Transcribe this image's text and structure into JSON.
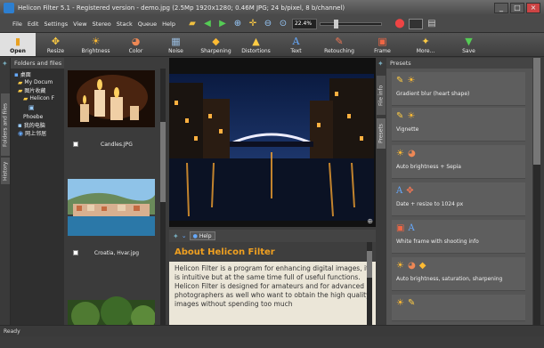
{
  "window": {
    "title": "Helicon Filter 5.1 - Registered version - demo.jpg (2.5Mp 1920x1280; 0.46M JPG; 24 b/pixel, 8 b/channel)",
    "minimize": "_",
    "maximize": "□",
    "close": "×"
  },
  "menu": [
    "File",
    "Edit",
    "Settings",
    "View",
    "Stereo",
    "Stack",
    "Queue",
    "Help"
  ],
  "zoom": {
    "value": "22.4%",
    "level": 0.224
  },
  "tools": [
    {
      "label": "Open",
      "icon": "▮"
    },
    {
      "label": "Resize",
      "icon": "✥"
    },
    {
      "label": "Brightness",
      "icon": "☀"
    },
    {
      "label": "Color",
      "icon": "◕"
    },
    {
      "label": "Noise",
      "icon": "▦"
    },
    {
      "label": "Sharpening",
      "icon": "◆"
    },
    {
      "label": "Distortions",
      "icon": "▲"
    },
    {
      "label": "Text",
      "icon": "A"
    },
    {
      "label": "Retouching",
      "icon": "✎"
    },
    {
      "label": "Frame",
      "icon": "▣"
    },
    {
      "label": "More...",
      "icon": "✦"
    },
    {
      "label": "Save",
      "icon": "▼"
    }
  ],
  "folders": {
    "title": "Folders and files",
    "nodes": [
      "桌面",
      "My Docum",
      "图片收藏",
      "Helicon F",
      "Phoebe",
      "我的电脑",
      "网上邻居"
    ]
  },
  "left_tabs": {
    "folders": "Folders and files",
    "history": "History"
  },
  "thumbnails": [
    "Candles.JPG",
    "Croatia, Hvar.jpg"
  ],
  "help": {
    "button": "Help"
  },
  "about": {
    "heading": "About Helicon Filter",
    "body": "Helicon Filter is a program for enhancing digital images, it is intuitive but at the same time full of useful functions. Helicon Filter is designed for amateurs and for advanced photographers as well who want to obtain the high quality images without spending too much"
  },
  "right_tabs": {
    "file_info": "File info",
    "presets": "Presets"
  },
  "presets": {
    "title": "Presets",
    "items": [
      {
        "name": "Gradient blur (heart shape)",
        "icons": [
          "✎",
          "☀"
        ]
      },
      {
        "name": "Vignette",
        "icons": [
          "✎",
          "☀"
        ]
      },
      {
        "name": "Auto brightness + Sepia",
        "icons": [
          "☀",
          "◕"
        ]
      },
      {
        "name": "Date + resize to 1024 px",
        "icons": [
          "A",
          "✥"
        ]
      },
      {
        "name": "White frame with shooting info",
        "icons": [
          "▣",
          "A"
        ]
      },
      {
        "name": "Auto brightness, saturation, sharpening",
        "icons": [
          "☀",
          "◕",
          "◆"
        ]
      },
      {
        "name": "",
        "icons": [
          "☀",
          "✎"
        ]
      }
    ]
  },
  "status": "Ready"
}
